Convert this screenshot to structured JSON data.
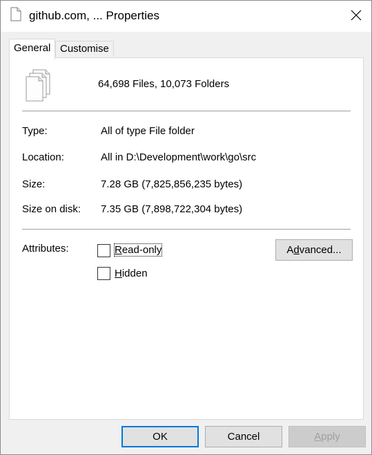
{
  "window": {
    "title": "github.com, ... Properties",
    "close_glyph": "✕"
  },
  "tabs": [
    {
      "label": "General",
      "active": true
    },
    {
      "label": "Customise",
      "active": false
    }
  ],
  "general": {
    "summary": "64,698 Files, 10,073 Folders",
    "rows": [
      {
        "label": "Type:",
        "value": "All of type File folder"
      },
      {
        "label": "Location:",
        "value": "All in D:\\Development\\work\\go\\src"
      },
      {
        "label": "Size:",
        "value": "7.28 GB (7,825,856,235 bytes)"
      },
      {
        "label": "Size on disk:",
        "value": "7.35 GB (7,898,722,304 bytes)"
      }
    ],
    "attributes_label": "Attributes:",
    "readonly": {
      "prefix": "",
      "access": "R",
      "rest": "ead-only",
      "checked": false
    },
    "hidden": {
      "prefix": "",
      "access": "H",
      "rest": "idden",
      "checked": false
    },
    "advanced": {
      "prefix": "A",
      "access": "d",
      "rest": "vanced..."
    }
  },
  "buttons": {
    "ok": "OK",
    "cancel": "Cancel",
    "apply_access": "A",
    "apply_rest": "pply"
  },
  "icons": {
    "title_icon": "document-icon",
    "files_icon": "multiple-files-icon",
    "close_icon": "close-icon"
  },
  "colors": {
    "accent": "#0078d7",
    "panel_bg": "#ffffff",
    "window_bg": "#f0f0f0"
  }
}
